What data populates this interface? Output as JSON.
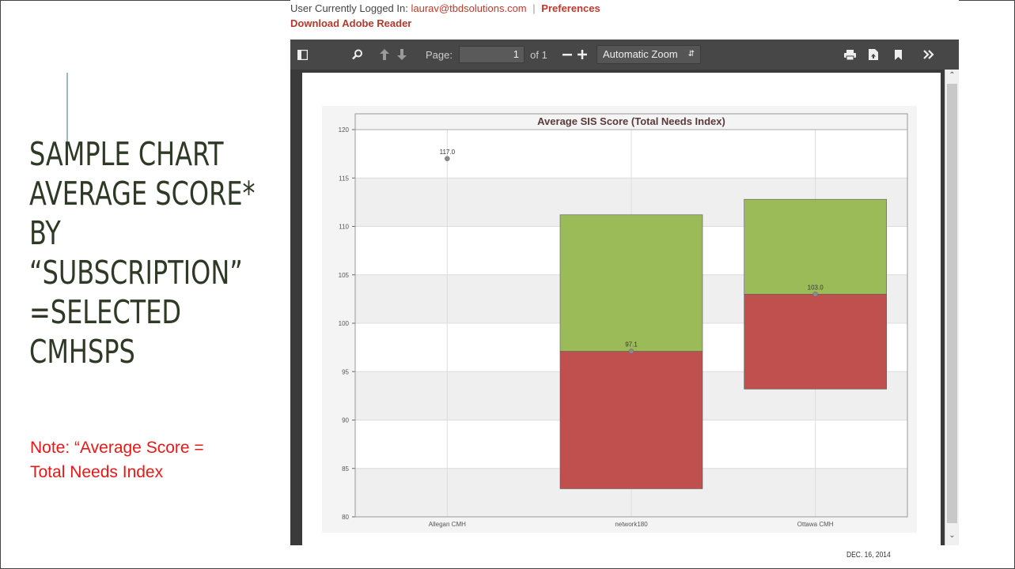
{
  "slide": {
    "title_lines": [
      "Sample Chart",
      "Average Score*",
      "by",
      "“Subscription”",
      "=Selected",
      "CMHSPs"
    ],
    "note": "Note: “Average Score = Total Needs Index",
    "footer_date": "DEC. 16, 2014"
  },
  "browser": {
    "login_prefix": "User Currently Logged In:",
    "login_email": "laurav@tbdsolutions.com",
    "separator": "|",
    "preferences_link": "Preferences",
    "adobe_link": "Download Adobe Reader"
  },
  "pdf_toolbar": {
    "page_label": "Page:",
    "page_value": "1",
    "page_total": "of 1",
    "zoom_value": "Automatic Zoom",
    "icons": [
      "sidebar-toggle-icon",
      "search-icon",
      "previous-page-icon",
      "next-page-icon",
      "zoom-out-icon",
      "zoom-in-icon",
      "print-icon",
      "download-icon",
      "bookmark-icon",
      "tools-menu-icon"
    ]
  },
  "chart_data": {
    "type": "bar",
    "title": "Average SIS Score (Total Needs Index)",
    "categories": [
      "Allegan CMH",
      "network180",
      "Ottawa CMH"
    ],
    "ylim": [
      80,
      120
    ],
    "yticks": [
      80,
      85,
      90,
      95,
      100,
      105,
      110,
      115,
      120
    ],
    "grid": true,
    "legend": "none",
    "series": [
      {
        "color": "#c0504d",
        "ranges": [
          null,
          [
            82.9,
            97.1
          ],
          [
            93.2,
            103.0
          ]
        ]
      },
      {
        "color": "#9bbb59",
        "ranges": [
          null,
          [
            97.1,
            111.2
          ],
          [
            103.0,
            112.8
          ]
        ]
      }
    ],
    "points": [
      {
        "category": "Allegan CMH",
        "value": 117.0,
        "label": "117.0"
      },
      {
        "category": "network180",
        "value": 97.1,
        "label": "97.1"
      },
      {
        "category": "Ottawa CMH",
        "value": 103.0,
        "label": "103.0"
      }
    ]
  }
}
